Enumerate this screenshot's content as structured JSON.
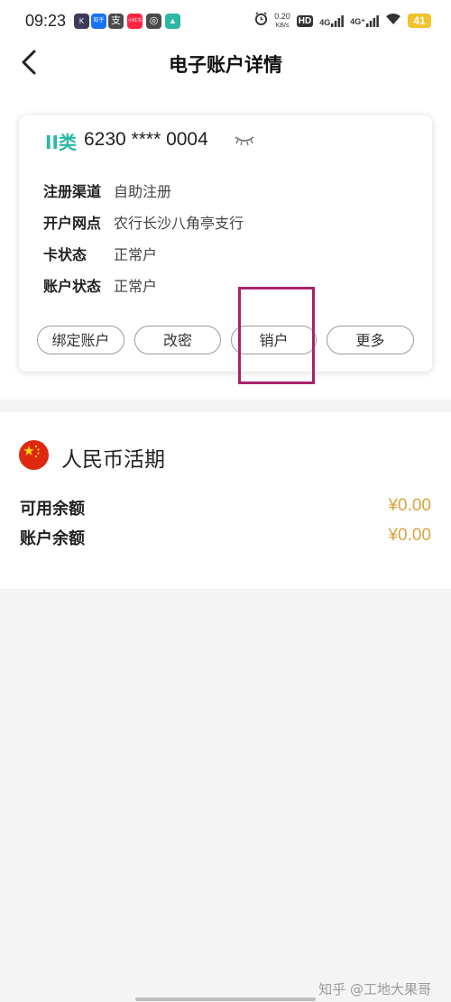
{
  "status_bar": {
    "time": "09:23",
    "app_icons": [
      {
        "name": "kuaishou-app-icon",
        "label": "K",
        "color": "#3c3c5a"
      },
      {
        "name": "zhihu-app-icon",
        "label": "知乎",
        "color": "#1772f6"
      },
      {
        "name": "alipay-app-icon",
        "label": "支",
        "color": "#4a4a4a"
      },
      {
        "name": "xiaohongshu-app-icon",
        "label": "小红书",
        "color": "#ff2442"
      },
      {
        "name": "weibo-app-icon",
        "label": "◎",
        "color": "#4a4a4a"
      },
      {
        "name": "bank-app-icon",
        "label": "▲",
        "color": "#2bb8a4"
      }
    ],
    "net_speed_value": "0.20",
    "net_speed_unit": "KB/s",
    "hd_label": "HD",
    "signal1": "4G",
    "signal2": "4G⁺",
    "battery": "41"
  },
  "header": {
    "title": "电子账户详情"
  },
  "card": {
    "account_type": "II类",
    "account_number": "6230 **** 0004",
    "rows": [
      {
        "label": "注册渠道",
        "value": "自助注册"
      },
      {
        "label": "开户网点",
        "value": "农行长沙八角亭支行"
      },
      {
        "label": "卡状态",
        "value": "正常户"
      },
      {
        "label": "账户状态",
        "value": "正常户"
      }
    ],
    "buttons": [
      "绑定账户",
      "改密",
      "销户",
      "更多"
    ]
  },
  "account_section": {
    "title": "人民币活期",
    "balances": [
      {
        "label": "可用余额",
        "value": "¥0.00"
      },
      {
        "label": "账户余额",
        "value": "¥0.00"
      }
    ]
  },
  "watermark": "知乎 @工地大果哥",
  "colors": {
    "accent": "#2bb8a4",
    "amount": "#d9a441",
    "highlight": "#a8226b",
    "flag_red": "#de2910",
    "flag_star": "#ffde00"
  }
}
